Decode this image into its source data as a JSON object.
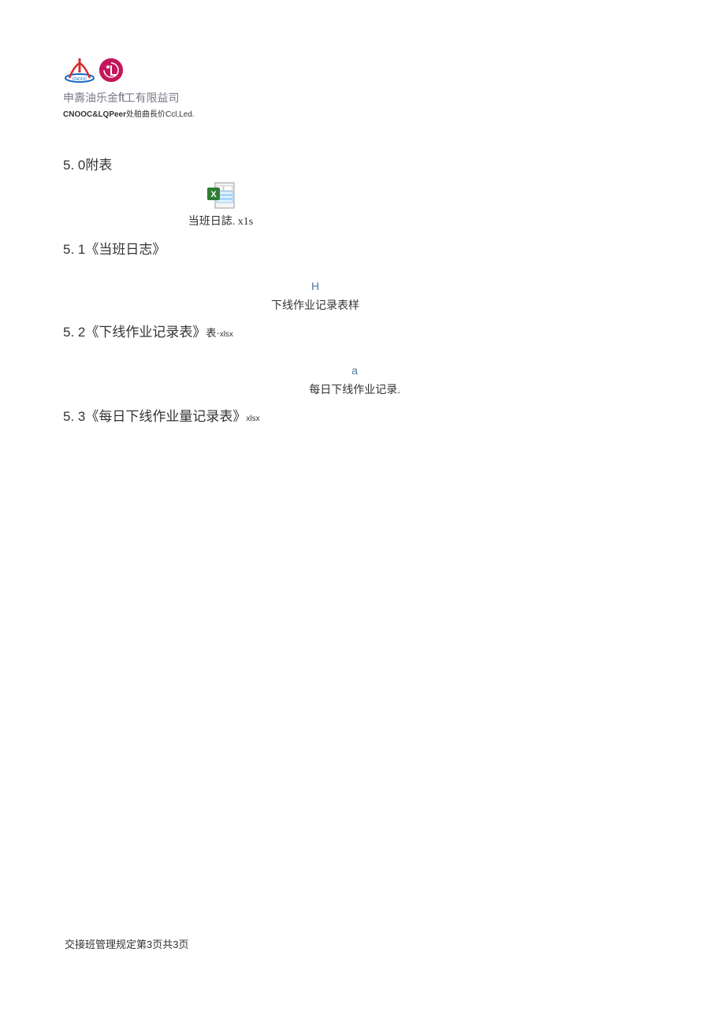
{
  "header": {
    "company_cn_prefix": "申壽油乐金",
    "company_cn_ft": "ft",
    "company_cn_suffix": "工有限益司",
    "company_en_bold": "CNOOC&LQPeer",
    "company_en_rest": "处舶曲長价Ccl,Led."
  },
  "sections": {
    "s50": {
      "number": "5. 0",
      "title": "附表"
    },
    "attachment1": {
      "filename": "当班日誌. x1s"
    },
    "s51": {
      "number": "5. 1",
      "title": "《当班日志》"
    },
    "letter_h": "H",
    "sub_h": "下线作业记录表样",
    "s52": {
      "number": "5. 2",
      "title": "《下线作业记录表》",
      "suffix": "表·",
      "ext": "xlsx"
    },
    "letter_a": "a",
    "sub_a": "每日下线作业记录.",
    "s53": {
      "number": "5. 3",
      "title": "《每日下线作业量记录表》",
      "ext": "xlsx"
    }
  },
  "footer": {
    "text": "交接班管理规定第3页共3页"
  }
}
